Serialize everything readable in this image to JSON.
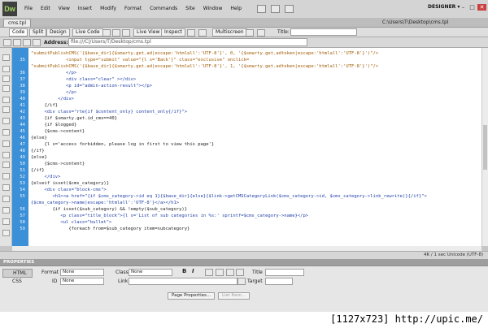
{
  "app": {
    "logo": "Dw",
    "menus": [
      "File",
      "Edit",
      "View",
      "Insert",
      "Modify",
      "Format",
      "Commands",
      "Site",
      "Window",
      "Help"
    ],
    "workspace": "DESIGNER",
    "workspace_arrow": "▾",
    "window_buttons": [
      "–",
      "□",
      "✕"
    ]
  },
  "document": {
    "tab": "cms.tpl",
    "path": "C:\\Users\\T\\Desktop\\cms.tpl"
  },
  "doc_toolbar": {
    "code": "Code",
    "split": "Split",
    "design": "Design",
    "live_code": "Live Code",
    "live_view": "Live View",
    "inspect": "Inspect",
    "multiscreen": "Multiscreen",
    "title_label": "Title:",
    "title_value": ""
  },
  "address": {
    "label": "Address:",
    "value": "file:///C|/Users/T/Desktop/cms.tpl"
  },
  "code": {
    "lines": [
      {
        "n": "",
        "text": "\"submitPublishCMS('{$base_dir}{$smarty.get.ad|escape:'htmlall':'UTF-8'}', 0, '{$smarty.get.adtoken|escape:'htmlall':'UTF-8'}')\"/>"
      },
      {
        "n": "35",
        "text": "             <input type=\"submit\" value=\"{l s='Back'}\" class=\"exclusive\" onclick="
      },
      {
        "n": "",
        "text": "\"submitPublishCMS('{$base_dir}{$smarty.get.ad|escape:'htmlall':'UTF-8'}', 1, '{$smarty.get.adtoken|escape:'htmlall':'UTF-8'}')\"/>"
      },
      {
        "n": "36",
        "text": "             </p>"
      },
      {
        "n": "37",
        "text": "             <div class=\"clear\" ></div>"
      },
      {
        "n": "38",
        "text": "             <p id=\"admin-action-result\"></p>"
      },
      {
        "n": "39",
        "text": "             </p>"
      },
      {
        "n": "40",
        "text": "          </div>"
      },
      {
        "n": "41",
        "text": "     {/if}"
      },
      {
        "n": "42",
        "text": "     <div class=\"rte{if $content_only} content_only{/if}\">"
      },
      {
        "n": "43",
        "text": "     {if $smarty.get.id_cms==40}"
      },
      {
        "n": "44",
        "text": "     {if $logged}"
      },
      {
        "n": "45",
        "text": "     {$cms->content}"
      },
      {
        "n": "46",
        "text": "{else}"
      },
      {
        "n": "47",
        "text": "     {l s='access forbidden, please log in first to view this page'}"
      },
      {
        "n": "48",
        "text": "{/if}"
      },
      {
        "n": "49",
        "text": "{else}"
      },
      {
        "n": "50",
        "text": "     {$cms->content}"
      },
      {
        "n": "51",
        "text": "{/if}"
      },
      {
        "n": "52",
        "text": "     </div>"
      },
      {
        "n": "53",
        "text": "{elseif isset($cms_category)}"
      },
      {
        "n": "54",
        "text": "     <div class=\"block-cms\">"
      },
      {
        "n": "55",
        "text": "        <h1><a href=\"{if $cms_category->id eq 1}{$base_dir}{else}{$link->getCMSCategoryLink($cms_category->id, $cms_category->link_rewrite)}{/if}\">"
      },
      {
        "n": "",
        "text": "{$cms_category->name|escape:'htmlall':'UTF-8'}</a></h1>"
      },
      {
        "n": "56",
        "text": "        {if isset($sub_category) && !empty($sub_category)}"
      },
      {
        "n": "57",
        "text": "           <p class=\"title_block\">{l s='List of sub categories in %s:' sprintf=$cms_category->name}</p>"
      },
      {
        "n": "58",
        "text": "           <ul class=\"bullet\">"
      },
      {
        "n": "59",
        "text": "              {foreach from=$sub_category item=subcategory}"
      }
    ]
  },
  "status": {
    "text": "4K / 1 sec  Unicode (UTF-8)"
  },
  "properties": {
    "header": "PROPERTIES",
    "html_btn": "HTML",
    "css_btn": "CSS",
    "format_label": "Format",
    "format_value": "None",
    "class_label": "Class",
    "class_value": "None",
    "id_label": "ID",
    "id_value": "None",
    "link_label": "Link",
    "link_value": "",
    "title_label": "Title",
    "title_value": "",
    "target_label": "Target",
    "target_value": "",
    "bold": "B",
    "italic": "I",
    "page_properties": "Page Properties...",
    "list_item": "List Item..."
  },
  "watermark": "[1127x723] http://upic.me/"
}
